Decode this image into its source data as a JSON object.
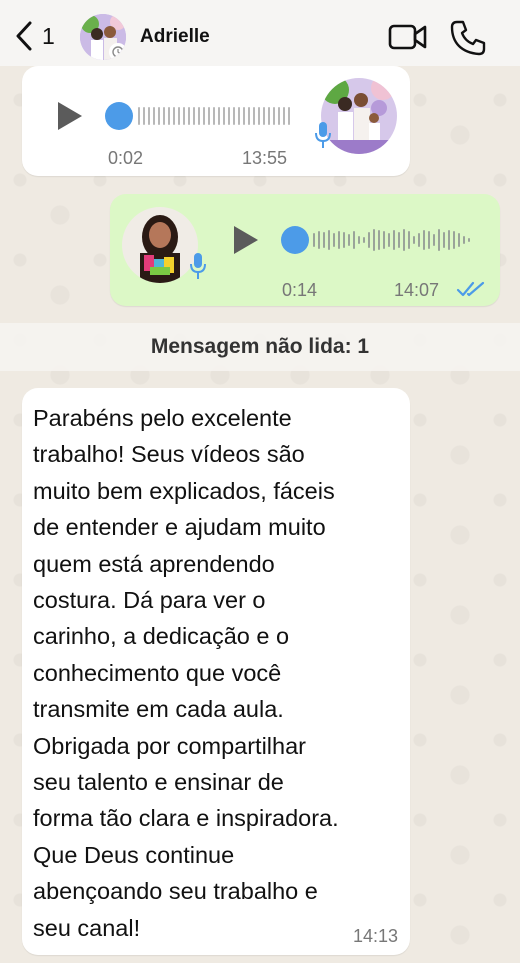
{
  "header": {
    "back_count": "1",
    "contact_name": "Adrielle",
    "icons": [
      "back-chevron-icon",
      "video-call-icon",
      "phone-call-icon"
    ]
  },
  "messages": {
    "voice_in": {
      "duration": "0:02",
      "time": "13:55"
    },
    "voice_out": {
      "duration": "0:14",
      "time": "14:07",
      "read_status": "double-check-read"
    },
    "unread_divider": "Mensagem não lida: 1",
    "text_in": {
      "body": "Parabéns pelo excelente\ntrabalho! Seus vídeos são\nmuito bem explicados, fáceis\nde entender e ajudam muito\nquem está aprendendo\ncostura. Dá para ver o\ncarinho, a dedicação e o\nconhecimento que você\ntransmite em cada aula.\nObrigada por compartilhar\nseu talento e ensinar de\nforma tão clara e inspiradora.\nQue Deus continue\nabençoando seu trabalho e\nseu canal!",
      "time": "14:13"
    }
  },
  "colors": {
    "outgoing_bubble": "#dcf8c6",
    "incoming_bubble": "#ffffff",
    "accent_blue": "#4c9be8",
    "chat_background": "#efeae2"
  }
}
